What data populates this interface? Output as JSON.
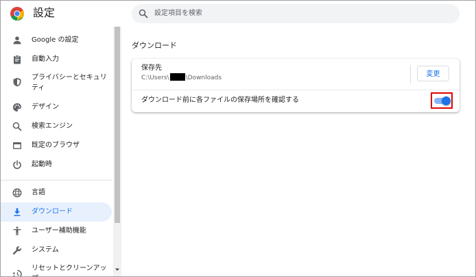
{
  "header": {
    "title": "設定",
    "search_placeholder": "設定項目を検索"
  },
  "sidebar": {
    "items": [
      {
        "label": "Google の設定",
        "icon": "person-icon"
      },
      {
        "label": "自動入力",
        "icon": "clipboard-icon"
      },
      {
        "label": "プライバシーとセキュリティ",
        "icon": "shield-icon"
      },
      {
        "label": "デザイン",
        "icon": "palette-icon"
      },
      {
        "label": "検索エンジン",
        "icon": "search-icon"
      },
      {
        "label": "既定のブラウザ",
        "icon": "browser-window-icon"
      },
      {
        "label": "起動時",
        "icon": "power-icon"
      },
      {
        "label": "言語",
        "icon": "globe-icon"
      },
      {
        "label": "ダウンロード",
        "icon": "download-icon",
        "active": true
      },
      {
        "label": "ユーザー補助機能",
        "icon": "accessibility-icon"
      },
      {
        "label": "システム",
        "icon": "wrench-icon"
      },
      {
        "label": "リセットとクリーンアップ",
        "icon": "reset-icon"
      }
    ]
  },
  "main": {
    "section_title": "ダウンロード",
    "location": {
      "label": "保存先",
      "path_prefix": "C:\\Users\\",
      "path_suffix": "\\Downloads",
      "change_button": "変更"
    },
    "ask_before_download": {
      "label": "ダウンロード前に各ファイルの保存場所を確認する",
      "enabled": true
    }
  },
  "colors": {
    "accent": "#1a73e8",
    "active_bg": "#e8f0fe",
    "highlight_border": "#e00000"
  }
}
